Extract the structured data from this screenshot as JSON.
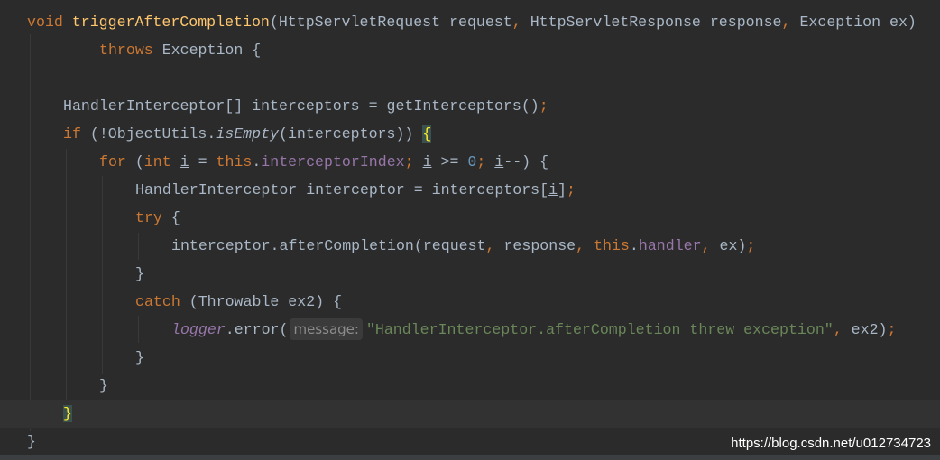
{
  "editor": {
    "colors": {
      "background": "#2b2b2b",
      "keyword": "#cc7832",
      "method_declaration": "#ffc66d",
      "default": "#a9b7c6",
      "field": "#9876aa",
      "string": "#6a8759",
      "number": "#6897bb",
      "current_line": "#323232"
    },
    "current_line": 15,
    "lines": [
      {
        "n": 1,
        "indent": 0,
        "tokens": [
          {
            "t": "void",
            "c": "kw"
          },
          {
            "t": " "
          },
          {
            "t": "triggerAfterCompletion",
            "c": "fn"
          },
          {
            "t": "(HttpServletRequest request"
          },
          {
            "t": ",",
            "c": "kw"
          },
          {
            "t": " HttpServletResponse response"
          },
          {
            "t": ",",
            "c": "kw"
          },
          {
            "t": " Exception ex)"
          }
        ]
      },
      {
        "n": 2,
        "indent": 8,
        "tokens": [
          {
            "t": "throws",
            "c": "kw"
          },
          {
            "t": " Exception {"
          }
        ]
      },
      {
        "n": 3,
        "indent": 0,
        "tokens": []
      },
      {
        "n": 4,
        "indent": 4,
        "tokens": [
          {
            "t": "HandlerInterceptor[] interceptors = getInterceptors()"
          },
          {
            "t": ";",
            "c": "kw"
          }
        ]
      },
      {
        "n": 5,
        "indent": 4,
        "tokens": [
          {
            "t": "if",
            "c": "kw"
          },
          {
            "t": " (!ObjectUtils."
          },
          {
            "t": "isEmpty",
            "c": "italic"
          },
          {
            "t": "(interceptors)) "
          },
          {
            "t": "{",
            "c": "brace-match"
          }
        ]
      },
      {
        "n": 6,
        "indent": 8,
        "tokens": [
          {
            "t": "for",
            "c": "kw"
          },
          {
            "t": " ("
          },
          {
            "t": "int",
            "c": "kw"
          },
          {
            "t": " "
          },
          {
            "t": "i",
            "c": "ul"
          },
          {
            "t": " = "
          },
          {
            "t": "this",
            "c": "kw"
          },
          {
            "t": "."
          },
          {
            "t": "interceptorIndex",
            "c": "field"
          },
          {
            "t": ";",
            "c": "kw"
          },
          {
            "t": " "
          },
          {
            "t": "i",
            "c": "ul"
          },
          {
            "t": " >= "
          },
          {
            "t": "0",
            "c": "num"
          },
          {
            "t": ";",
            "c": "kw"
          },
          {
            "t": " "
          },
          {
            "t": "i",
            "c": "ul"
          },
          {
            "t": "--) {"
          }
        ]
      },
      {
        "n": 7,
        "indent": 12,
        "tokens": [
          {
            "t": "HandlerInterceptor interceptor = interceptors["
          },
          {
            "t": "i",
            "c": "ul"
          },
          {
            "t": "]"
          },
          {
            "t": ";",
            "c": "kw"
          }
        ]
      },
      {
        "n": 8,
        "indent": 12,
        "tokens": [
          {
            "t": "try",
            "c": "kw"
          },
          {
            "t": " {"
          }
        ]
      },
      {
        "n": 9,
        "indent": 16,
        "tokens": [
          {
            "t": "interceptor.afterCompletion(request"
          },
          {
            "t": ",",
            "c": "kw"
          },
          {
            "t": " response"
          },
          {
            "t": ",",
            "c": "kw"
          },
          {
            "t": " "
          },
          {
            "t": "this",
            "c": "kw"
          },
          {
            "t": "."
          },
          {
            "t": "handler",
            "c": "field"
          },
          {
            "t": ",",
            "c": "kw"
          },
          {
            "t": " ex)"
          },
          {
            "t": ";",
            "c": "kw"
          }
        ]
      },
      {
        "n": 10,
        "indent": 12,
        "tokens": [
          {
            "t": "}"
          }
        ]
      },
      {
        "n": 11,
        "indent": 12,
        "tokens": [
          {
            "t": "catch",
            "c": "kw"
          },
          {
            "t": " (Throwable ex2) {"
          }
        ]
      },
      {
        "n": 12,
        "indent": 16,
        "tokens": [
          {
            "t": "logger",
            "c": "field italic"
          },
          {
            "t": ".error("
          },
          {
            "t": "message:",
            "c": "hint"
          },
          {
            "t": "\"HandlerInterceptor.afterCompletion threw exception\"",
            "c": "str"
          },
          {
            "t": ",",
            "c": "kw"
          },
          {
            "t": " ex2)"
          },
          {
            "t": ";",
            "c": "kw"
          }
        ]
      },
      {
        "n": 13,
        "indent": 12,
        "tokens": [
          {
            "t": "}"
          }
        ]
      },
      {
        "n": 14,
        "indent": 8,
        "tokens": [
          {
            "t": "}"
          }
        ]
      },
      {
        "n": 15,
        "indent": 4,
        "tokens": [
          {
            "t": "}",
            "c": "brace-match"
          }
        ]
      },
      {
        "n": 16,
        "indent": 0,
        "tokens": [
          {
            "t": "}"
          }
        ]
      }
    ]
  },
  "watermark": "https://blog.csdn.net/u012734723"
}
